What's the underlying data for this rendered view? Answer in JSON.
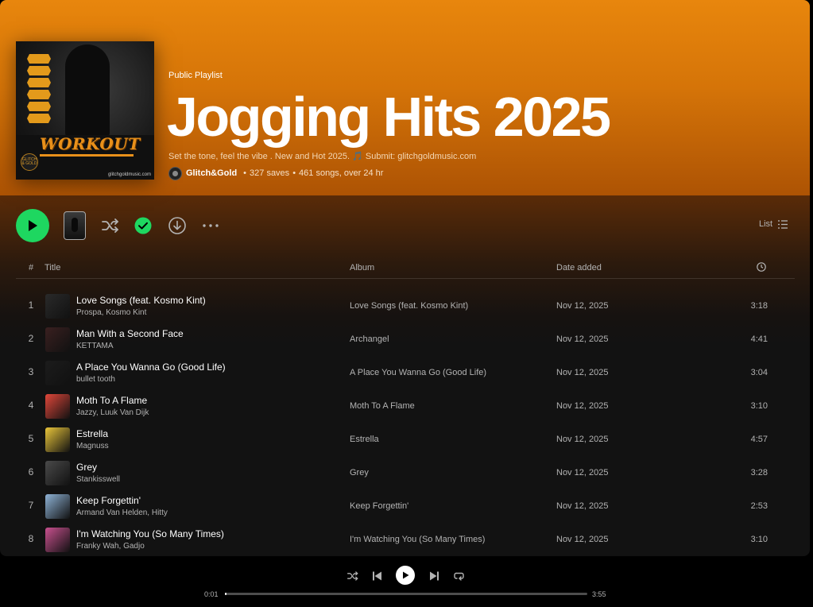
{
  "playlist": {
    "type_label": "Public Playlist",
    "title": "Jogging Hits 2025",
    "description": "Set the tone, feel the vibe . New and Hot 2025. 🎵 Submit: glitchgoldmusic.com",
    "owner": "Glitch&Gold",
    "saves": "327 saves",
    "songs": "461 songs, over 24 hr",
    "cover": {
      "text": "WORKOUT",
      "seal_text": "GLITCH & GOLD",
      "site": "glitchgoldmusic.com"
    }
  },
  "actions": {
    "play": "play-icon",
    "shuffle": "shuffle-icon",
    "saved": "check-circle-icon",
    "download": "download-icon",
    "more": "more-icon",
    "view_label": "List"
  },
  "table": {
    "headers": {
      "num": "#",
      "title": "Title",
      "album": "Album",
      "date": "Date added",
      "duration": "clock-icon"
    },
    "rows": [
      {
        "num": "1",
        "title": "Love Songs (feat. Kosmo Kint)",
        "artist": "Prospa, Kosmo Kint",
        "album": "Love Songs (feat. Kosmo Kint)",
        "date": "Nov 12, 2025",
        "duration": "3:18",
        "art_color": "#2a2a2a"
      },
      {
        "num": "2",
        "title": "Man With a Second Face",
        "artist": "KETTAMA",
        "album": "Archangel",
        "date": "Nov 12, 2025",
        "duration": "4:41",
        "art_color": "#3a2020"
      },
      {
        "num": "3",
        "title": "A Place You Wanna Go (Good Life)",
        "artist": "bullet tooth",
        "album": "A Place You Wanna Go (Good Life)",
        "date": "Nov 12, 2025",
        "duration": "3:04",
        "art_color": "#1c1c1c"
      },
      {
        "num": "4",
        "title": "Moth To A Flame",
        "artist": "Jazzy, Luuk Van Dijk",
        "album": "Moth To A Flame",
        "date": "Nov 12, 2025",
        "duration": "3:10",
        "art_color": "#e0473a"
      },
      {
        "num": "5",
        "title": "Estrella",
        "artist": "Magnuss",
        "album": "Estrella",
        "date": "Nov 12, 2025",
        "duration": "4:57",
        "art_color": "#e9c53a"
      },
      {
        "num": "6",
        "title": "Grey",
        "artist": "Stankisswell",
        "album": "Grey",
        "date": "Nov 12, 2025",
        "duration": "3:28",
        "art_color": "#4a4a4a"
      },
      {
        "num": "7",
        "title": "Keep Forgettin'",
        "artist": "Armand Van Helden, Hitty",
        "album": "Keep Forgettin'",
        "date": "Nov 12, 2025",
        "duration": "2:53",
        "art_color": "#8fb3d6"
      },
      {
        "num": "8",
        "title": "I'm Watching You (So Many Times)",
        "artist": "Franky Wah, Gadjo",
        "album": "I'm Watching You (So Many Times)",
        "date": "Nov 12, 2025",
        "duration": "3:10",
        "art_color": "#c8508f"
      }
    ]
  },
  "player": {
    "current_time": "0:01",
    "total_time": "3:55",
    "progress_fraction": 0.004
  },
  "colors": {
    "accent": "#1ed760",
    "hero_top": "#e8860d",
    "hero_bottom": "#ad5304"
  }
}
